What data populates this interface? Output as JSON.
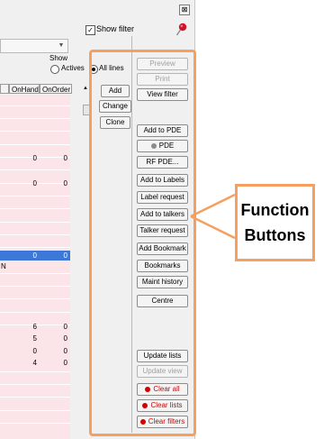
{
  "window": {
    "close_glyph": "⊠",
    "show_filter_label": "Show filter",
    "show_filter_checked": "✓"
  },
  "show_group": {
    "label": "Show",
    "actives": "Actives",
    "all_lines": "All lines"
  },
  "table": {
    "headers": [
      "OnHand",
      "OnOrder"
    ],
    "visible_values": [
      {
        "onhand": "0",
        "onorder": "0"
      },
      {
        "onhand": "0",
        "onorder": "0"
      },
      {
        "onhand": "0",
        "onorder": "0"
      },
      {
        "onhand": "6",
        "onorder": "0"
      },
      {
        "onhand": "5",
        "onorder": "0"
      },
      {
        "onhand": "0",
        "onorder": "0"
      },
      {
        "onhand": "4",
        "onorder": "0"
      }
    ],
    "stray_letter": "N"
  },
  "left_buttons": {
    "add": "Add",
    "change": "Change",
    "clone": "Clone"
  },
  "function_buttons": {
    "preview": "Preview",
    "print": "Print",
    "view_filter": "View filter",
    "add_to_pde": "Add to PDE",
    "pde": "PDE",
    "rf_pde": "RF PDE...",
    "add_to_labels": "Add to Labels",
    "label_request": "Label request",
    "add_to_talkers": "Add to talkers",
    "talker_request": "Talker request",
    "add_bookmark": "Add Bookmark",
    "bookmarks": "Bookmarks",
    "maint_history": "Maint history",
    "centre": "Centre",
    "update_lists": "Update lists",
    "update_view": "Update view",
    "clear_all": "Clear all",
    "clear_lists": "Clear lists",
    "clear_filters": "Clear filters"
  },
  "callout": {
    "line1": "Function",
    "line2": "Buttons"
  },
  "colors": {
    "accent_orange": "#f5a060",
    "row_pink": "#fce5e8",
    "selection_blue": "#3c78d8",
    "clear_red": "#d40000",
    "pin_red": "#d0152a"
  }
}
